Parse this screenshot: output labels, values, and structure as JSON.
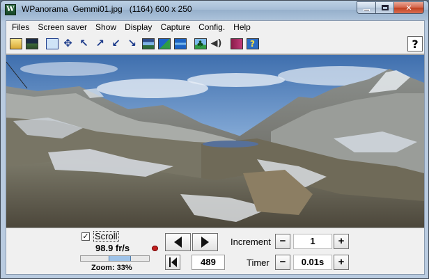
{
  "window": {
    "title": "WPanorama  Gemmi01.jpg   (1164) 600 x 250",
    "app_icon_letter": "W"
  },
  "menu": [
    "Files",
    "Screen saver",
    "Show",
    "Display",
    "Capture",
    "Config.",
    "Help"
  ],
  "toolbar": {
    "buttons": [
      {
        "name": "open-file-icon",
        "glyph": "▭"
      },
      {
        "name": "picture-icon",
        "glyph": "▲"
      },
      {
        "name": "window-fit-icon",
        "glyph": "▢"
      },
      {
        "name": "move-all-directions-icon",
        "glyph": "✥"
      },
      {
        "name": "arrow-up-left-icon",
        "glyph": "↖"
      },
      {
        "name": "arrow-up-right-icon",
        "glyph": "↗"
      },
      {
        "name": "arrow-down-left-icon",
        "glyph": "↙"
      },
      {
        "name": "arrow-down-right-icon",
        "glyph": "↘"
      },
      {
        "name": "panorama-strip-icon",
        "glyph": "▬"
      },
      {
        "name": "landscape-icon",
        "glyph": "◢"
      },
      {
        "name": "panorama-wide-icon",
        "glyph": "═"
      },
      {
        "name": "tree-icon",
        "glyph": "♣"
      },
      {
        "name": "speaker-icon",
        "glyph": "🔈"
      },
      {
        "name": "book-icon",
        "glyph": "📖"
      },
      {
        "name": "help-book-icon",
        "glyph": "?"
      }
    ],
    "help_label": "?"
  },
  "controls": {
    "scroll_checked": true,
    "scroll_label": "Scroll",
    "speed": "98.9 fr/s",
    "zoom_label": "Zoom: 33%",
    "zoom_percent": 33,
    "position_value": "489",
    "increment_label": "Increment",
    "increment_value": "1",
    "timer_label": "Timer",
    "timer_value": "0.01s",
    "minus": "−",
    "plus": "+"
  }
}
